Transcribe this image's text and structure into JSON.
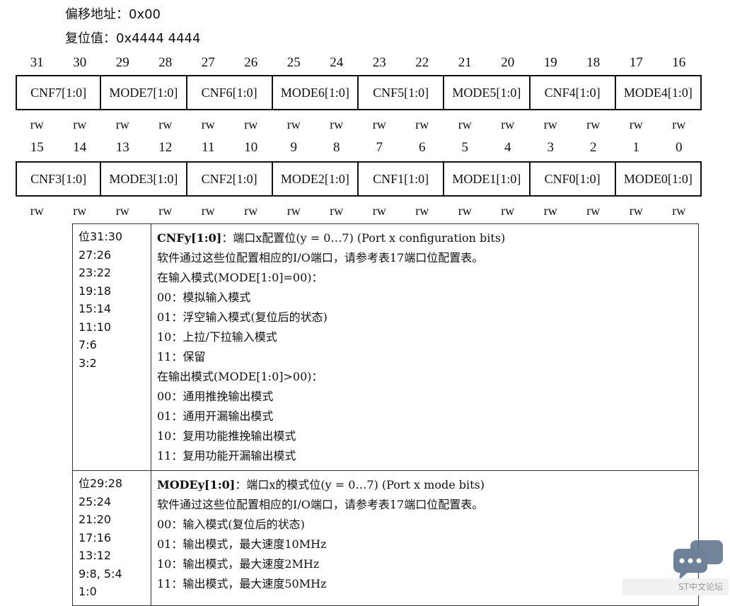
{
  "header": {
    "offset_label": "偏移地址：",
    "offset_value": "0x00",
    "reset_label": "复位值：",
    "reset_value": "0x4444 4444"
  },
  "upper_bits": [
    "31",
    "30",
    "29",
    "28",
    "27",
    "26",
    "25",
    "24",
    "23",
    "22",
    "21",
    "20",
    "19",
    "18",
    "17",
    "16"
  ],
  "upper_fields": [
    "CNF7[1:0]",
    "MODE7[1:0]",
    "CNF6[1:0]",
    "MODE6[1:0]",
    "CNF5[1:0]",
    "MODE5[1:0]",
    "CNF4[1:0]",
    "MODE4[1:0]"
  ],
  "lower_bits": [
    "15",
    "14",
    "13",
    "12",
    "11",
    "10",
    "9",
    "8",
    "7",
    "6",
    "5",
    "4",
    "3",
    "2",
    "1",
    "0"
  ],
  "lower_fields": [
    "CNF3[1:0]",
    "MODE3[1:0]",
    "CNF2[1:0]",
    "MODE2[1:0]",
    "CNF1[1:0]",
    "MODE1[1:0]",
    "CNF0[1:0]",
    "MODE0[1:0]"
  ],
  "access": "rw",
  "cnf": {
    "bits": [
      "位31:30",
      "27:26",
      "23:22",
      "19:18",
      "15:14",
      "11:10",
      "7:6",
      "3:2"
    ],
    "title_bold": "CNFy[1:0]",
    "title_rest": "：端口x配置位(y = 0…7) (Port x configuration bits)",
    "lines": [
      "软件通过这些位配置相应的I/O端口，请参考表17端口位配置表。",
      "在输入模式(MODE[1:0]=00)：",
      "00：模拟输入模式",
      "01：浮空输入模式(复位后的状态)",
      "10：上拉/下拉输入模式",
      "11：保留",
      "在输出模式(MODE[1:0]>00)：",
      "00：通用推挽输出模式",
      "01：通用开漏输出模式",
      "10：复用功能推挽输出模式",
      "11：复用功能开漏输出模式"
    ]
  },
  "mode": {
    "bits": [
      "位29:28",
      "25:24",
      "21:20",
      "17:16",
      "13:12",
      "9:8, 5:4",
      "1:0"
    ],
    "title_bold": "MODEy[1:0]",
    "title_rest": "：端口x的模式位(y = 0…7) (Port x mode bits)",
    "lines": [
      "软件通过这些位配置相应的I/O端口，请参考表17端口位配置表。",
      "00：输入模式(复位后的状态)",
      "01：输出模式，最大速度10MHz",
      "10：输出模式，最大速度2MHz",
      "11：输出模式，最大速度50MHz"
    ]
  },
  "watermark": "ST中文论坛",
  "colors": {
    "logo": "#5a6f8a"
  }
}
